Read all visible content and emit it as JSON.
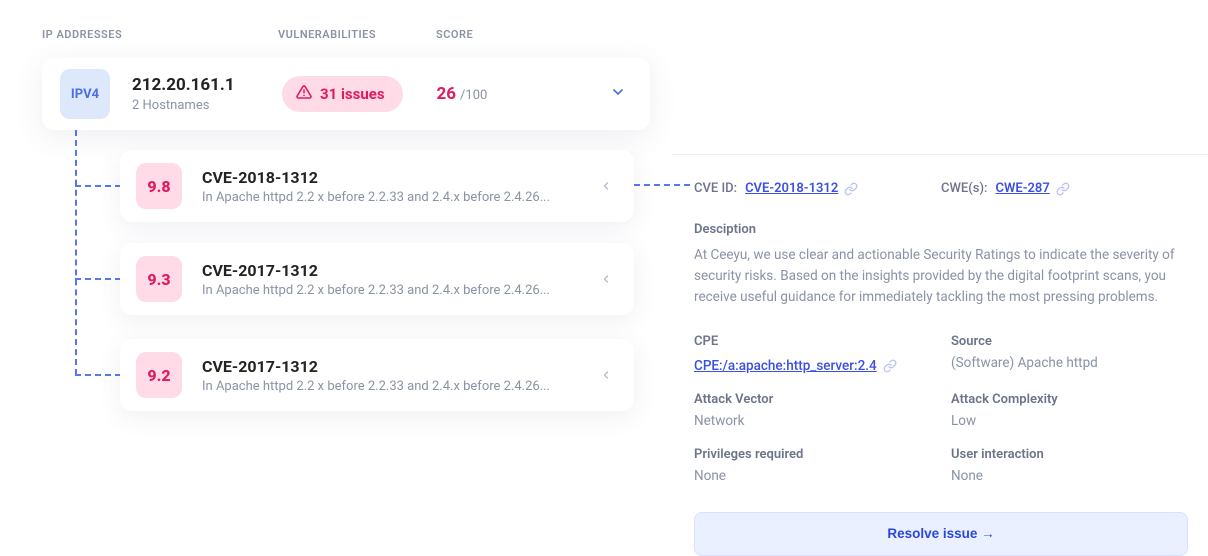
{
  "headers": {
    "ip": "IP ADDRESSES",
    "vuln": "VULNERABILITIES",
    "score": "SCORE"
  },
  "ip_card": {
    "badge": "IPV4",
    "address": "212.20.161.1",
    "hostnames": "2 Hostnames",
    "issues_label": "31 issues",
    "score_value": "26",
    "score_max": "/100"
  },
  "vulns": [
    {
      "severity": "9.8",
      "cve": "CVE-2018-1312",
      "desc": "In Apache httpd 2.2 x before 2.2.33 and 2.4.x before 2.4.26..."
    },
    {
      "severity": "9.3",
      "cve": "CVE-2017-1312",
      "desc": "In Apache httpd 2.2 x before 2.2.33 and 2.4.x before 2.4.26..."
    },
    {
      "severity": "9.2",
      "cve": "CVE-2017-1312",
      "desc": "In Apache httpd 2.2 x before 2.2.33 and 2.4.x before 2.4.26..."
    }
  ],
  "details": {
    "cve_id_label": "CVE ID:",
    "cve_id_value": "CVE-2018-1312",
    "cwe_label": "CWE(s):",
    "cwe_value": "CWE-287",
    "description_label": "Desciption",
    "description_body": "At Ceeyu, we use clear and actionable Security Ratings to indicate the severity of security risks. Based on the insights provided by the digital footprint scans, you receive useful guidance for immediately tackling the most pressing problems.",
    "cpe_label": "CPE",
    "cpe_value": "CPE:/a:apache:http_server:2.4",
    "source_label": "Source",
    "source_value": "(Software) Apache httpd",
    "attack_vector_label": "Attack Vector",
    "attack_vector_value": "Network",
    "attack_complexity_label": "Attack Complexity",
    "attack_complexity_value": "Low",
    "privileges_label": "Privileges required",
    "privileges_value": "None",
    "user_interaction_label": "User interaction",
    "user_interaction_value": "None",
    "resolve_label": "Resolve issue →"
  }
}
